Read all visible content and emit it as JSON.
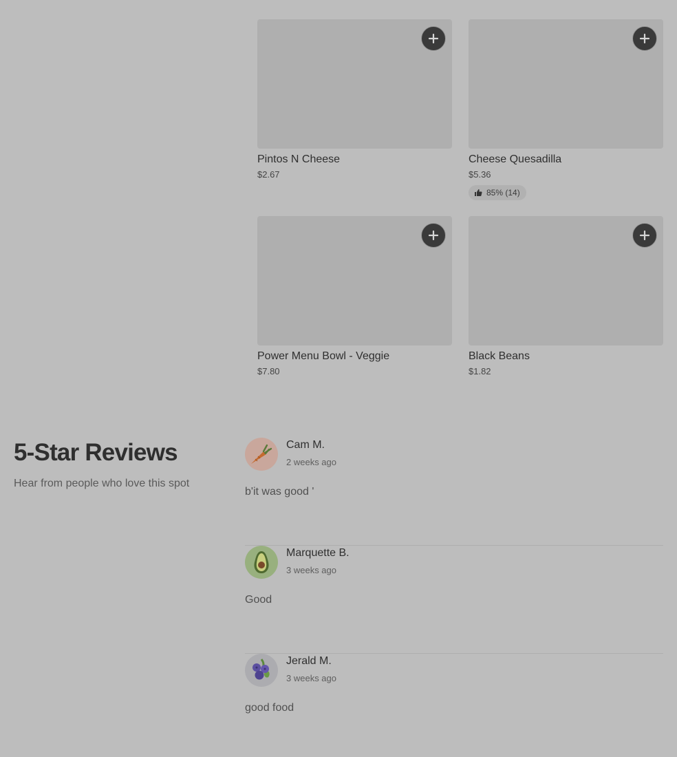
{
  "menu": {
    "items": [
      {
        "name": "Pintos N Cheese",
        "price": "$2.67",
        "rating": ""
      },
      {
        "name": "Cheese Quesadilla",
        "price": "$5.36",
        "rating": "85% (14)"
      },
      {
        "name": "Power Menu Bowl - Veggie",
        "price": "$7.80",
        "rating": ""
      },
      {
        "name": "Black Beans",
        "price": "$1.82",
        "rating": ""
      }
    ],
    "add_icon": "plus-icon",
    "rating_icon": "thumbs-up-icon"
  },
  "reviews_section": {
    "title": "5-Star Reviews",
    "subtitle": "Hear from people who love this spot",
    "reviews": [
      {
        "name": "Cam M.",
        "time": "2 weeks ago",
        "text": "b'it was good '",
        "avatar_icon": "carrot-icon",
        "avatar_color": "#c9a79c"
      },
      {
        "name": "Marquette B.",
        "time": "3 weeks ago",
        "text": "Good",
        "avatar_icon": "avocado-icon",
        "avatar_color": "#98b07e"
      },
      {
        "name": "Jerald M.",
        "time": "3 weeks ago",
        "text": "good food",
        "avatar_icon": "blueberries-icon",
        "avatar_color": "#acacb0"
      }
    ]
  }
}
